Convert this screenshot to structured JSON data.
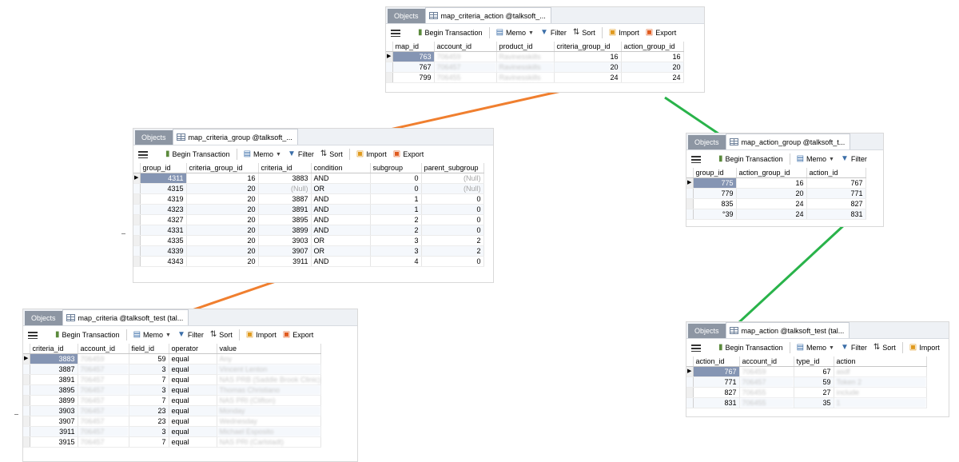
{
  "common": {
    "tab_objects": "Objects",
    "toolbar": {
      "begin_transaction": "Begin Transaction",
      "memo": "Memo",
      "filter": "Filter",
      "sort": "Sort",
      "import": "Import",
      "export": "Export"
    }
  },
  "windows": [
    {
      "tab_title": "map_criteria_action @talksoft_...",
      "columns": [
        "map_id",
        "account_id",
        "product_id",
        "criteria_group_id",
        "action_group_id"
      ],
      "rows": [
        [
          "763",
          "706459",
          "Ravinesskills",
          "16",
          "16"
        ],
        [
          "767",
          "706457",
          "Ravinesskills",
          "20",
          "20"
        ],
        [
          "799",
          "706455",
          "Ravinesskills",
          "24",
          "24"
        ]
      ]
    },
    {
      "tab_title": "map_criteria_group @talksoft_...",
      "columns": [
        "group_id",
        "criteria_group_id",
        "criteria_id",
        "condition",
        "subgroup",
        "parent_subgroup"
      ],
      "rows": [
        [
          "4311",
          "16",
          "3883",
          "AND",
          "0",
          "(Null)"
        ],
        [
          "4315",
          "20",
          "(Null)",
          "OR",
          "0",
          "(Null)"
        ],
        [
          "4319",
          "20",
          "3887",
          "AND",
          "1",
          "0"
        ],
        [
          "4323",
          "20",
          "3891",
          "AND",
          "1",
          "0"
        ],
        [
          "4327",
          "20",
          "3895",
          "AND",
          "2",
          "0"
        ],
        [
          "4331",
          "20",
          "3899",
          "AND",
          "2",
          "0"
        ],
        [
          "4335",
          "20",
          "3903",
          "OR",
          "3",
          "2"
        ],
        [
          "4339",
          "20",
          "3907",
          "OR",
          "3",
          "2"
        ],
        [
          "4343",
          "20",
          "3911",
          "AND",
          "4",
          "0"
        ]
      ]
    },
    {
      "tab_title": "map_action_group @talksoft_t...",
      "columns": [
        "group_id",
        "action_group_id",
        "action_id"
      ],
      "rows": [
        [
          "775",
          "16",
          "767"
        ],
        [
          "779",
          "20",
          "771"
        ],
        [
          "835",
          "24",
          "827"
        ],
        [
          "°39",
          "24",
          "831"
        ]
      ]
    },
    {
      "tab_title": "map_criteria @talksoft_test (tal...",
      "columns": [
        "criteria_id",
        "account_id",
        "field_id",
        "operator",
        "value"
      ],
      "rows": [
        [
          "3883",
          "706459",
          "59",
          "equal",
          "Any"
        ],
        [
          "3887",
          "706457",
          "3",
          "equal",
          "Vincent Lenton"
        ],
        [
          "3891",
          "706457",
          "7",
          "equal",
          "NAS PRB (Saddle Brook Clinic)"
        ],
        [
          "3895",
          "706457",
          "3",
          "equal",
          "Thomas Christiano"
        ],
        [
          "3899",
          "706457",
          "7",
          "equal",
          "NAS PRI (Clifton)"
        ],
        [
          "3903",
          "706457",
          "23",
          "equal",
          "Monday"
        ],
        [
          "3907",
          "706457",
          "23",
          "equal",
          "Wednesday"
        ],
        [
          "3911",
          "706457",
          "3",
          "equal",
          "Michael Esposito"
        ],
        [
          "3915",
          "706457",
          "7",
          "equal",
          "NAS PRI (Carlstadt)"
        ]
      ]
    },
    {
      "tab_title": "map_action @talksoft_test (tal...",
      "columns": [
        "action_id",
        "account_id",
        "type_id",
        "action"
      ],
      "rows": [
        [
          "767",
          "706459",
          "67",
          "asdf"
        ],
        [
          "771",
          "706457",
          "59",
          "Token 2"
        ],
        [
          "827",
          "706455",
          "27",
          "include"
        ],
        [
          "831",
          "706455",
          "35",
          "1"
        ]
      ]
    }
  ],
  "colors": {
    "orange_connector": "#f07f2f",
    "green_connector": "#29b34a",
    "selected_cell": "#8595b3"
  }
}
